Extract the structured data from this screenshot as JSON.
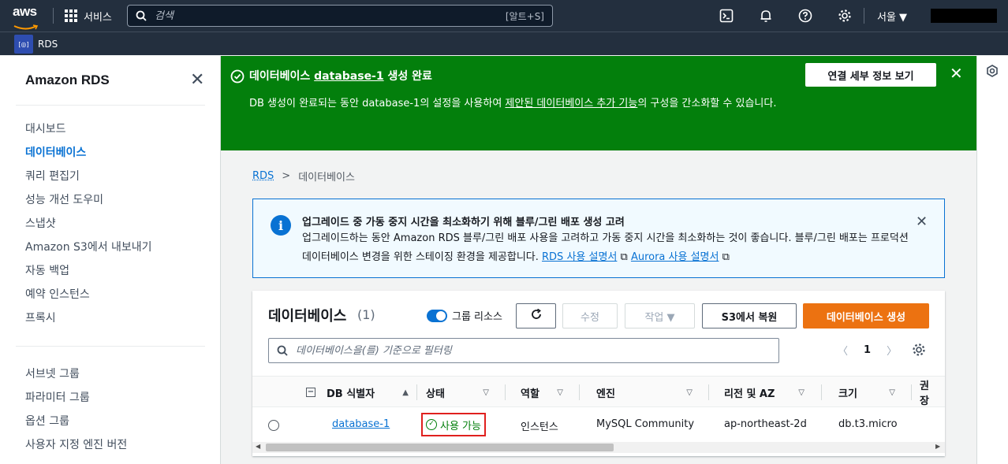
{
  "topbar": {
    "logo": "aws",
    "services": "서비스",
    "search_placeholder": "검색",
    "search_shortcut": "[알트+S]",
    "region": "서울 ▼"
  },
  "subbar": {
    "service_name": "RDS",
    "service_icon_text": "[◎]"
  },
  "sidenav": {
    "title": "Amazon RDS",
    "items": [
      "대시보드",
      "데이터베이스",
      "쿼리 편집기",
      "성능 개선 도우미",
      "스냅샷",
      "Amazon S3에서 내보내기",
      "자동 백업",
      "예약 인스턴스",
      "프록시"
    ],
    "active_index": 1,
    "items2": [
      "서브넷 그룹",
      "파라미터 그룹",
      "옵션 그룹",
      "사용자 지정 엔진 버전"
    ]
  },
  "flash": {
    "head_pre": "데이터베이스 ",
    "head_db": "database-1",
    "head_post": " 생성 완료",
    "body_pre": "DB 생성이 완료되는 동안 database-1의 설정을 사용하여 ",
    "body_link": "제안된 데이터베이스 추가 기능",
    "body_post": "의 구성을 간소화할 수 있습니다.",
    "button": "연결 세부 정보 보기"
  },
  "breadcrumb": {
    "root": "RDS",
    "sep": ">",
    "current": "데이터베이스"
  },
  "info": {
    "head": "업그레이드 중 가동 중지 시간을 최소화하기 위해 블루/그린 배포 생성 고려",
    "body": "업그레이드하는 동안 Amazon RDS 블루/그린 배포 사용을 고려하고 가동 중지 시간을 최소화하는 것이 좋습니다. 블루/그린 배포는 프로덕션 데이터베이스 변경을 위한 스테이징 환경을 제공합니다. ",
    "link1": "RDS 사용 설명서",
    "link2": "Aurora 사용 설명서"
  },
  "panel": {
    "title": "데이터베이스",
    "count": "(1)",
    "toggle_label": "그룹 리소스",
    "toggle_on": true,
    "btn_modify": "수정",
    "btn_actions": "작업 ▼",
    "btn_restore": "S3에서 복원",
    "btn_create": "데이터베이스 생성",
    "filter_placeholder": "데이터베이스을(를) 기준으로 필터링",
    "page": "1"
  },
  "table": {
    "columns": [
      "DB 식별자",
      "상태",
      "역할",
      "엔진",
      "리전 및 AZ",
      "크기",
      "권장"
    ],
    "rows": [
      {
        "id": "database-1",
        "status": "사용 가능",
        "role": "인스턴스",
        "engine": "MySQL Community",
        "region": "ap-northeast-2d",
        "size": "db.t3.micro"
      }
    ]
  },
  "colors": {
    "topbar": "#232f3e",
    "flash_success": "#037f0c",
    "primary": "#ec7211",
    "link": "#0972d3"
  }
}
